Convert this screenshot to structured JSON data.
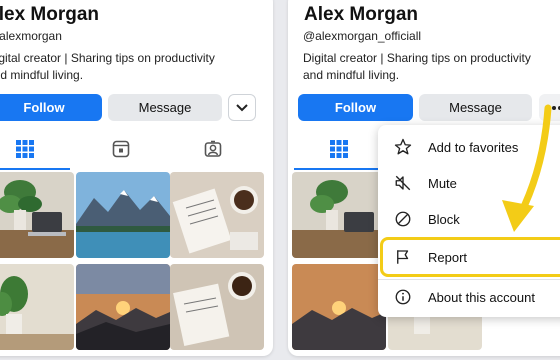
{
  "left_profile": {
    "name": "Alex Morgan",
    "handle": "@alexmorgan",
    "bio_line1": "Digital creator | Sharing tips on productivity",
    "bio_line2": "and mindful living.",
    "follow_label": "Follow",
    "message_label": "Message",
    "more_icon": "chevron-down-icon"
  },
  "right_profile": {
    "name": "Alex Morgan",
    "handle": "@alexmorgan_officiall",
    "bio_line1": "Digital creator | Sharing tips on productivity",
    "bio_line2": "and mindful living.",
    "follow_label": "Follow",
    "message_label": "Message",
    "more_icon": "ellipsis-icon"
  },
  "tabs": [
    {
      "icon": "grid-icon",
      "active": true
    },
    {
      "icon": "reels-icon",
      "active": false
    },
    {
      "icon": "tagged-icon",
      "active": false
    }
  ],
  "photo_tiles": [
    "plant-desk-photo",
    "mountain-lake-photo",
    "notebook-coffee-photo",
    "plant-window-photo",
    "sunset-mountain-photo",
    "journal-coffee-photo"
  ],
  "menu": {
    "items": [
      {
        "label": "Add to favorites",
        "icon": "star-icon"
      },
      {
        "label": "Mute",
        "icon": "mute-icon"
      },
      {
        "label": "Block",
        "icon": "block-icon"
      },
      {
        "label": "Report",
        "icon": "flag-icon",
        "highlighted": true
      },
      {
        "label": "About this account",
        "icon": "info-icon"
      }
    ]
  },
  "colors": {
    "accent": "#1877f2",
    "highlight": "#f3cc17",
    "arrow": "#f3cc17"
  }
}
